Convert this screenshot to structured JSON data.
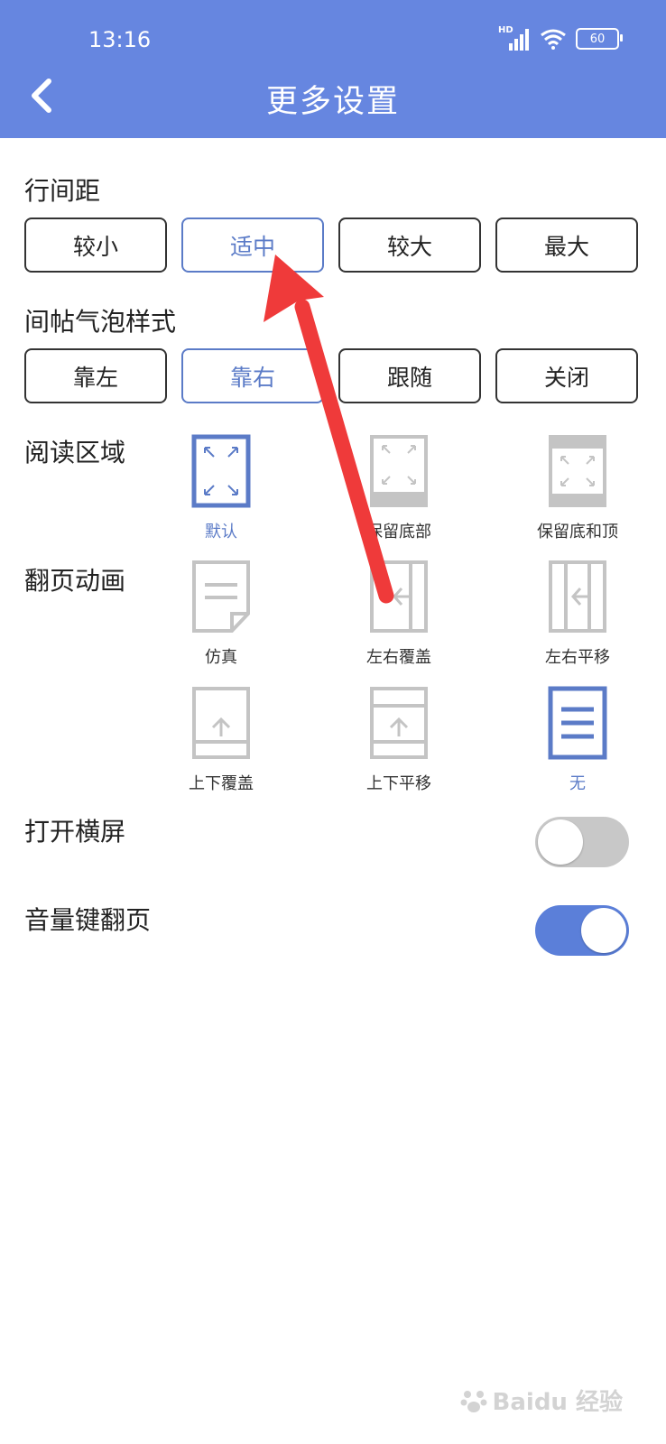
{
  "status": {
    "time": "13:16",
    "network": "HD",
    "battery": "60"
  },
  "header": {
    "title": "更多设置"
  },
  "line_spacing": {
    "label": "行间距",
    "options": [
      "较小",
      "适中",
      "较大",
      "最大"
    ],
    "selected": "适中"
  },
  "bubble_style": {
    "label": "间帖气泡样式",
    "options": [
      "靠左",
      "靠右",
      "跟随",
      "关闭"
    ],
    "selected": "靠右"
  },
  "reading_area": {
    "label": "阅读区域",
    "options": [
      "默认",
      "保留底部",
      "保留底和顶"
    ],
    "selected": "默认"
  },
  "page_anim": {
    "label": "翻页动画",
    "options": [
      "仿真",
      "左右覆盖",
      "左右平移",
      "上下覆盖",
      "上下平移",
      "无"
    ],
    "selected": "无"
  },
  "landscape": {
    "label": "打开横屏",
    "enabled": false
  },
  "volume_keys": {
    "label": "音量键翻页",
    "enabled": true
  },
  "colors": {
    "header": "#6686e0",
    "accent": "#5b7bc7",
    "toggle_on": "#5b7fd9",
    "annotation_arrow": "#ef3a3a"
  },
  "watermark": {
    "text": "Baidu 经验"
  }
}
